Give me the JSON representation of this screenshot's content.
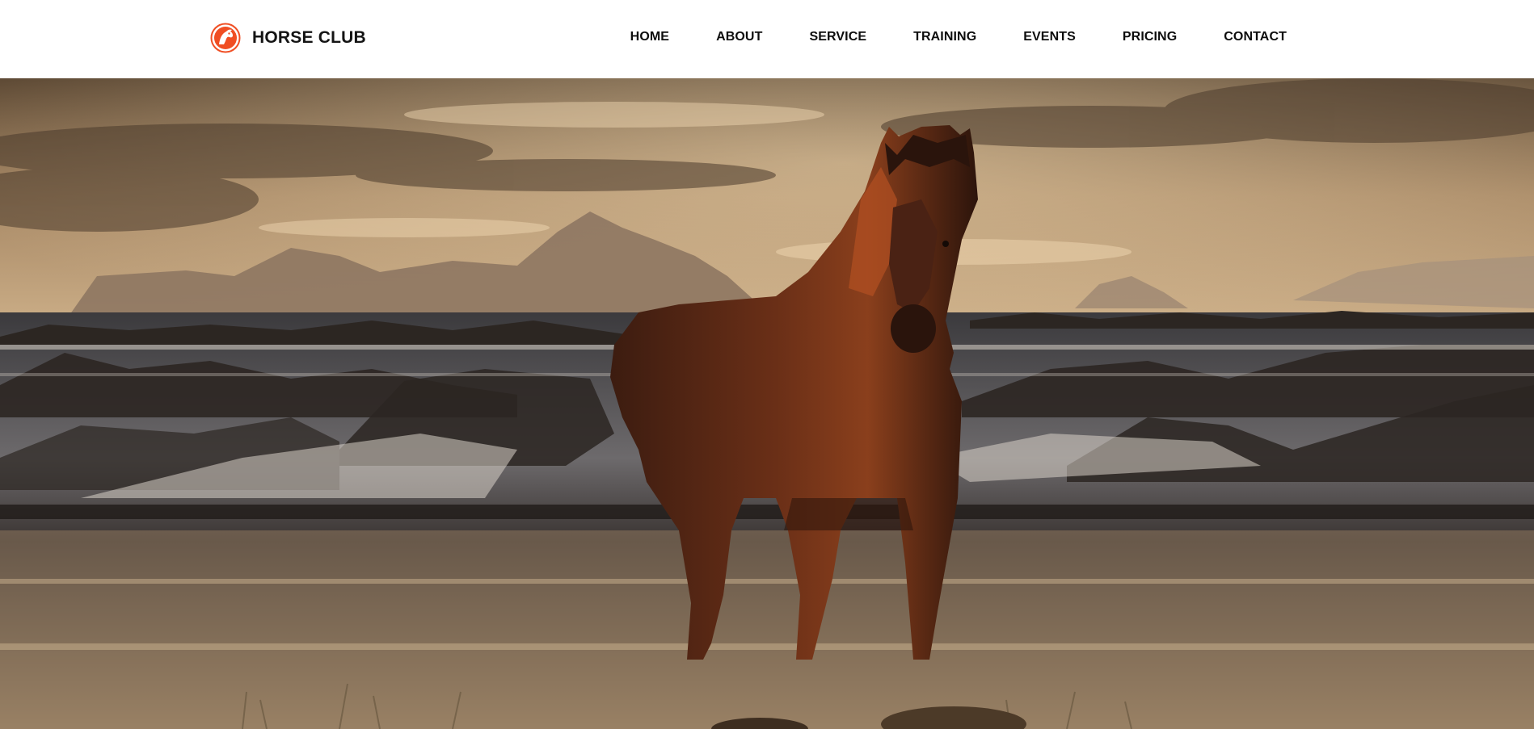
{
  "brand": {
    "name": "HORSE CLUB",
    "logo_icon": "horse-head-icon",
    "accent": "#f04e23"
  },
  "nav": {
    "items": [
      {
        "label": "HOME"
      },
      {
        "label": "ABOUT"
      },
      {
        "label": "SERVICE"
      },
      {
        "label": "TRAINING"
      },
      {
        "label": "EVENTS"
      },
      {
        "label": "PRICING"
      },
      {
        "label": "CONTACT"
      }
    ]
  },
  "hero": {
    "image": "horse-on-beach-at-sunset-photo"
  }
}
